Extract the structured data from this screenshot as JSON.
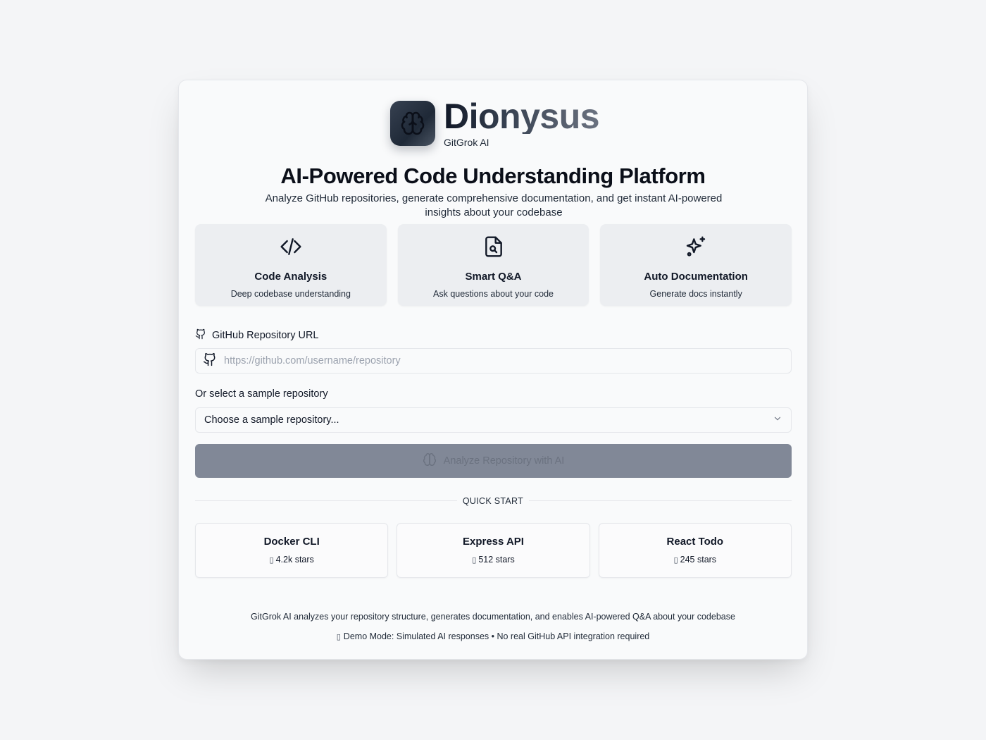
{
  "brand": {
    "name": "Dionysus",
    "subtitle": "GitGrok AI",
    "logo_icon": "brain-icon"
  },
  "hero": {
    "title": "AI-Powered Code Understanding Platform",
    "description": "Analyze GitHub repositories, generate comprehensive documentation, and get instant AI-powered insights about your codebase"
  },
  "features": [
    {
      "icon": "code-icon",
      "title": "Code Analysis",
      "description": "Deep codebase understanding"
    },
    {
      "icon": "file-search-icon",
      "title": "Smart Q&A",
      "description": "Ask questions about your code"
    },
    {
      "icon": "sparkles-icon",
      "title": "Auto Documentation",
      "description": "Generate docs instantly"
    }
  ],
  "repo_form": {
    "url_label": "GitHub Repository URL",
    "url_value": "",
    "url_placeholder": "https://github.com/username/repository",
    "sample_label": "Or select a sample repository",
    "sample_selected": "Choose a sample repository...",
    "analyze_label": "Analyze Repository with AI"
  },
  "quick_start": {
    "label": "QUICK START",
    "items": [
      {
        "name": "Docker CLI",
        "stars": "4.2k stars"
      },
      {
        "name": "Express API",
        "stars": "512 stars"
      },
      {
        "name": "React Todo",
        "stars": "245 stars"
      }
    ]
  },
  "footer": {
    "line1": "GitGrok AI analyzes your repository structure, generates documentation, and enables AI-powered Q&A about your codebase",
    "line2": "Demo Mode: Simulated AI responses • No real GitHub API integration required"
  },
  "colors": {
    "background": "#f4f5f7",
    "card": "#f9fafb",
    "feature_card": "#eceef1",
    "button_disabled": "#818897",
    "text": "#111827"
  }
}
